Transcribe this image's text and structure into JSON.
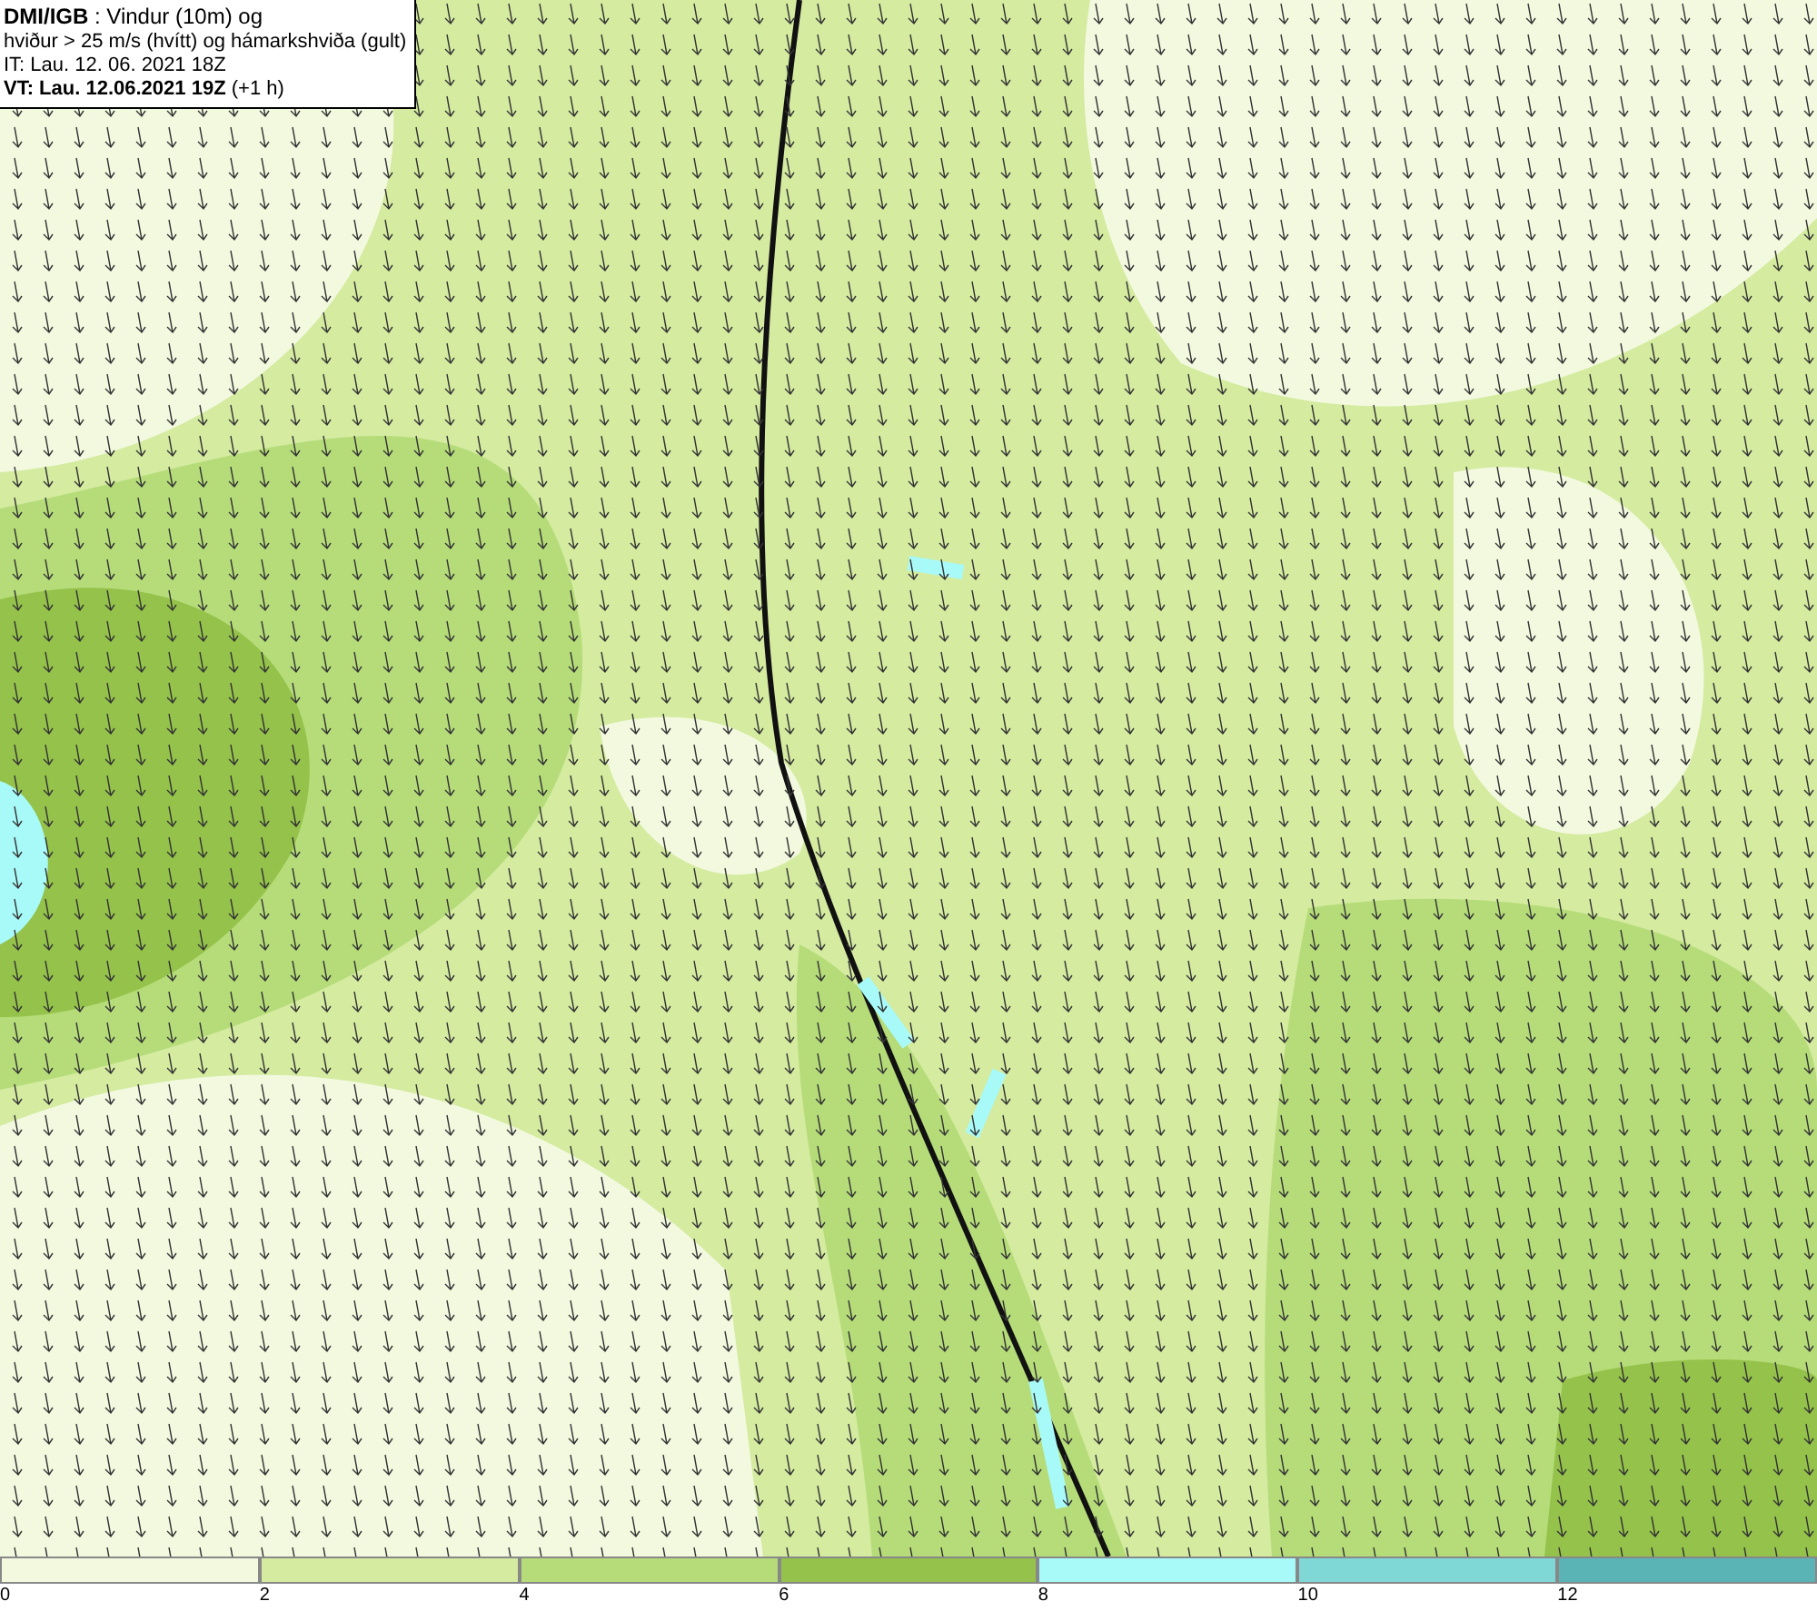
{
  "header": {
    "lines": [
      "**DMI/IGB** : Vindur (10m) og",
      "hviður > 25 m/s (hvítt) og hámarkshviða (gult)",
      "IT: Lau. 12. 06. 2021 18Z",
      "**VT: Lau. 12.06.2021 19Z** (+1 h)"
    ]
  },
  "legend": {
    "bins": [
      {
        "color": "#f2f9df",
        "label": "0"
      },
      {
        "color": "#d4eba0",
        "label": "2"
      },
      {
        "color": "#b5dc79",
        "label": "4"
      },
      {
        "color": "#94c24a",
        "label": "6"
      },
      {
        "color": "#a8faf8",
        "label": "8"
      },
      {
        "color": "#7fd8d6",
        "label": "10"
      },
      {
        "color": "#5ab3b5",
        "label": "12"
      }
    ]
  }
}
